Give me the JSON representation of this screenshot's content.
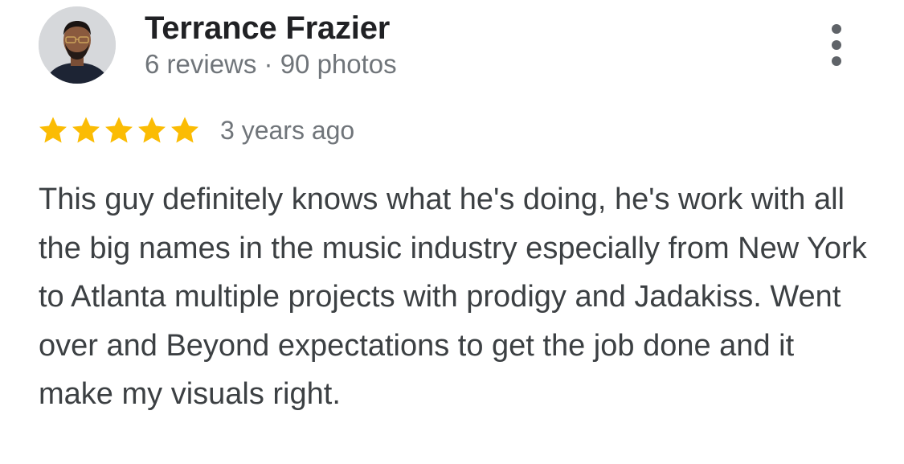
{
  "reviewer": {
    "name": "Terrance Frazier",
    "meta": "6 reviews · 90 photos"
  },
  "review": {
    "rating": 5,
    "max_rating": 5,
    "date": "3 years ago",
    "text": "This guy definitely knows what he's doing, he's work with all the big names in the music industry especially from New York to Atlanta multiple projects with prodigy and Jadakiss. Went over and Beyond expectations to get the job done and it make my visuals right."
  },
  "icons": {
    "star": "star-icon",
    "more": "more-vert-icon"
  },
  "colors": {
    "star": "#fbbc04",
    "name": "#202124",
    "meta": "#70757a",
    "body": "#3c4043"
  }
}
